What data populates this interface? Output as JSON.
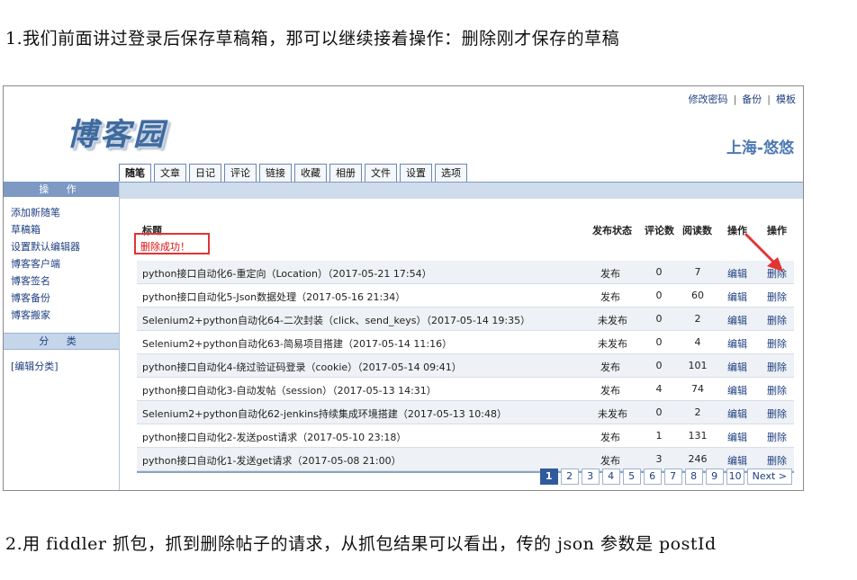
{
  "captions": {
    "intro": "1.我们前面讲过登录后保存草稿箱，那可以继续接着操作：删除刚才保存的草稿",
    "next": "2.用 fiddler 抓包，抓到删除帖子的请求，从抓包结果可以看出，传的 json 参数是 postId"
  },
  "site": {
    "logo": "博客园",
    "username": "上海-悠悠",
    "top_links": [
      "修改密码",
      "备份",
      "模板"
    ],
    "separator": "|"
  },
  "tabs": [
    "随笔",
    "文章",
    "日记",
    "评论",
    "链接",
    "收藏",
    "相册",
    "文件",
    "设置",
    "选项"
  ],
  "sidebar": {
    "ops_title": "操 作",
    "ops_items": [
      "添加新随笔",
      "草稿箱",
      "设置默认编辑器",
      "博客客户端",
      "博客签名",
      "博客备份",
      "博客搬家"
    ],
    "cat_title": "分 类",
    "cat_link": "[编辑分类]"
  },
  "table": {
    "headers": {
      "title": "标题",
      "status": "发布状态",
      "comments": "评论数",
      "views": "阅读数",
      "op1": "操作",
      "op2": "操作"
    },
    "success_msg": "删除成功！",
    "rows": [
      {
        "title": "python接口自动化6-重定向（Location）（2017-05-21 17:54）",
        "status": "发布",
        "comments": "0",
        "views": "7",
        "edit": "编辑",
        "del": "删除"
      },
      {
        "title": "python接口自动化5-Json数据处理（2017-05-16 21:34）",
        "status": "发布",
        "comments": "0",
        "views": "60",
        "edit": "编辑",
        "del": "删除"
      },
      {
        "title": "Selenium2+python自动化64-二次封装（click、send_keys）（2017-05-14 19:35）",
        "status": "未发布",
        "comments": "0",
        "views": "2",
        "edit": "编辑",
        "del": "删除"
      },
      {
        "title": "Selenium2+python自动化63-简易项目搭建（2017-05-14 11:16）",
        "status": "未发布",
        "comments": "0",
        "views": "4",
        "edit": "编辑",
        "del": "删除"
      },
      {
        "title": "python接口自动化4-绕过验证码登录（cookie）（2017-05-14 09:41）",
        "status": "发布",
        "comments": "0",
        "views": "101",
        "edit": "编辑",
        "del": "删除"
      },
      {
        "title": "python接口自动化3-自动发帖（session）（2017-05-13 14:31）",
        "status": "发布",
        "comments": "4",
        "views": "74",
        "edit": "编辑",
        "del": "删除"
      },
      {
        "title": "Selenium2+python自动化62-jenkins持续集成环境搭建（2017-05-13 10:48）",
        "status": "未发布",
        "comments": "0",
        "views": "2",
        "edit": "编辑",
        "del": "删除"
      },
      {
        "title": "python接口自动化2-发送post请求（2017-05-10 23:18）",
        "status": "发布",
        "comments": "1",
        "views": "131",
        "edit": "编辑",
        "del": "删除"
      },
      {
        "title": "python接口自动化1-发送get请求（2017-05-08 21:00）",
        "status": "发布",
        "comments": "3",
        "views": "246",
        "edit": "编辑",
        "del": "删除"
      }
    ]
  },
  "pagination": {
    "pages": [
      "1",
      "2",
      "3",
      "4",
      "5",
      "6",
      "7",
      "8",
      "9",
      "10"
    ],
    "current": "1",
    "next": "Next >"
  },
  "colors": {
    "accent": "#2f5a9c",
    "annotation": "#e23434"
  }
}
